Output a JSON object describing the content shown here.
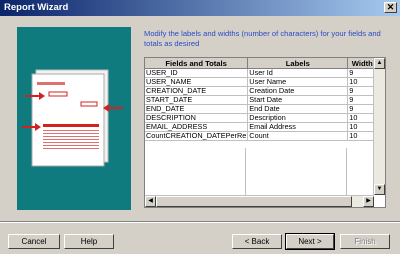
{
  "window": {
    "title": "Report Wizard",
    "close_glyph": "✕"
  },
  "instructions": "Modify the labels and widths (number of characters) for your fields and totals as desired",
  "grid": {
    "headers": [
      "Fields and Totals",
      "Labels",
      "Width"
    ],
    "rows": [
      [
        "USER_ID",
        "User Id",
        "9"
      ],
      [
        "USER_NAME",
        "User Name",
        "10"
      ],
      [
        "CREATION_DATE",
        "Creation Date",
        "9"
      ],
      [
        "START_DATE",
        "Start Date",
        "9"
      ],
      [
        "END_DATE",
        "End Date",
        "9"
      ],
      [
        "DESCRIPTION",
        "Description",
        "10"
      ],
      [
        "EMAIL_ADDRESS",
        "Email Address",
        "10"
      ],
      [
        "CountCREATION_DATEPerRe",
        "Count",
        "10"
      ]
    ]
  },
  "buttons": {
    "cancel": "Cancel",
    "help": "Help",
    "back": "< Back",
    "next": "Next >",
    "finish": "Finish"
  },
  "colors": {
    "panel": "#0f7b7f",
    "instructions": "#2a4bc6",
    "arrow": "#d42020"
  }
}
